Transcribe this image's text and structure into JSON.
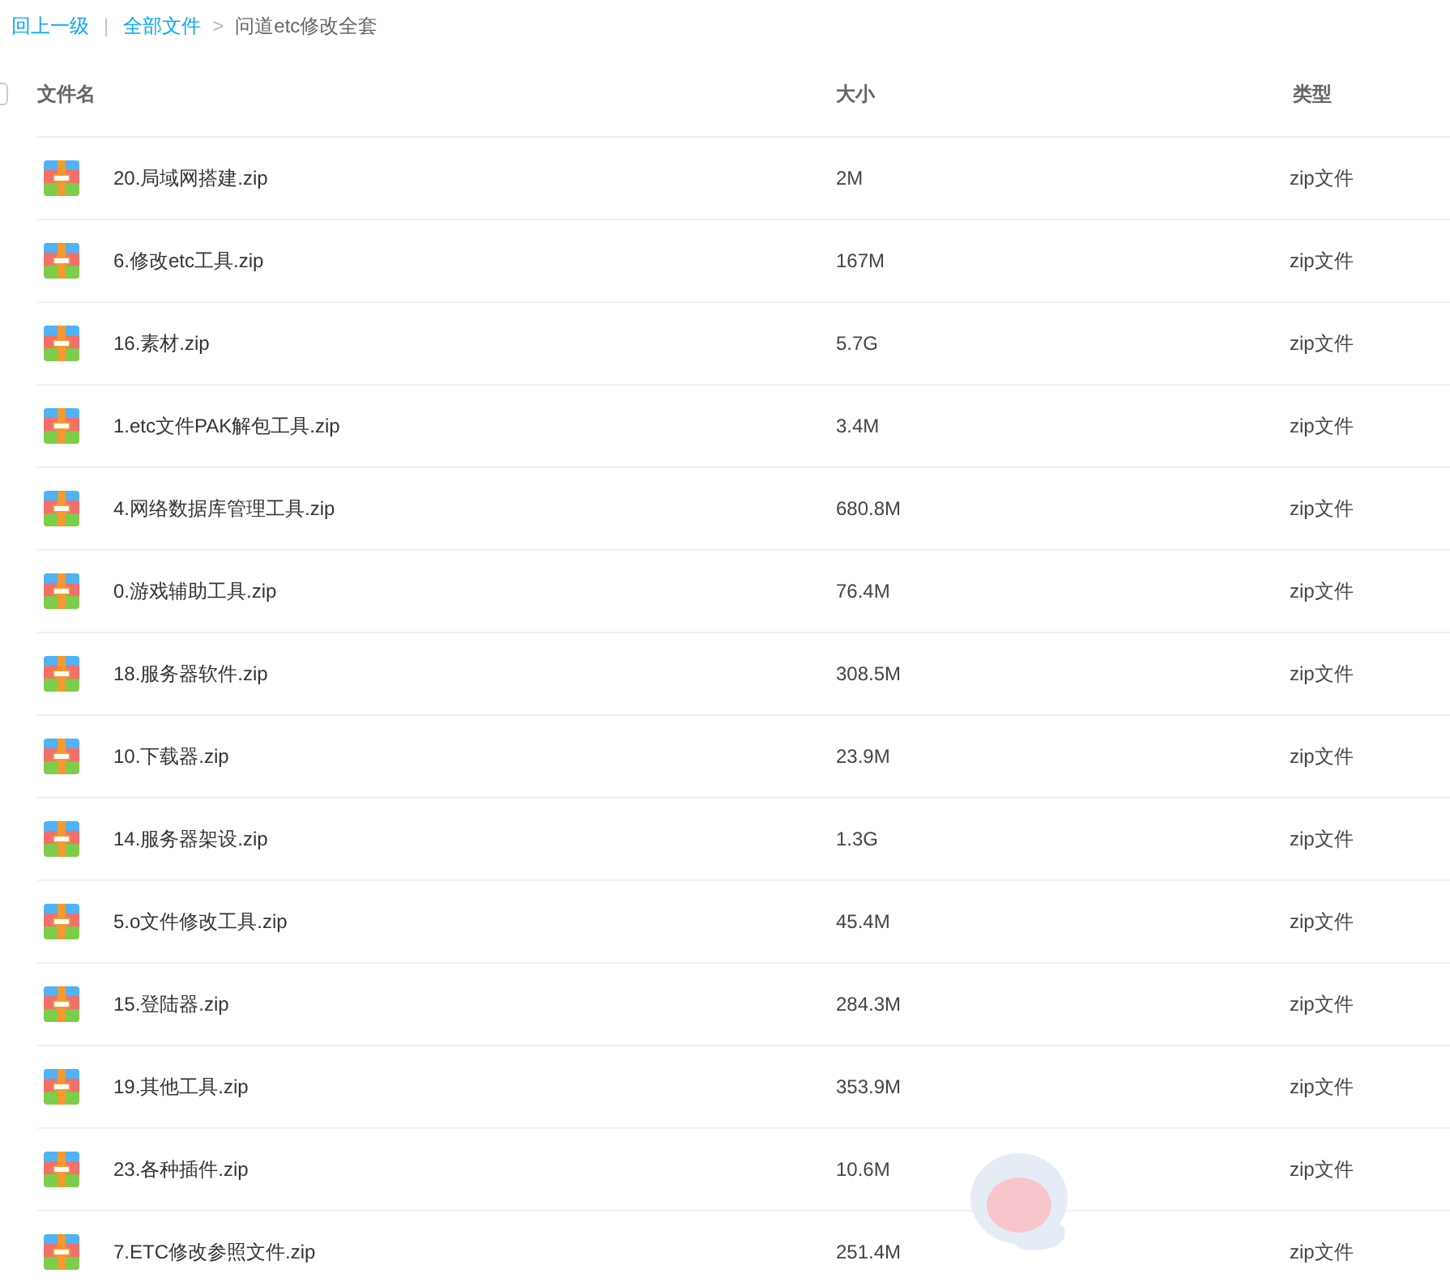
{
  "breadcrumb": {
    "back": "回上一级",
    "separator": "|",
    "items": [
      {
        "label": "全部文件",
        "selected": false
      },
      {
        "label": "问道etc修改全套",
        "selected": true
      }
    ],
    "arrow": ">"
  },
  "table": {
    "select_all": {
      "checked": false
    },
    "columns": [
      "文件名",
      "大小",
      "类型"
    ],
    "rows": [
      {
        "name": "20.局域网搭建.zip",
        "size": "2M",
        "type": "zip文件"
      },
      {
        "name": "6.修改etc工具.zip",
        "size": "167M",
        "type": "zip文件"
      },
      {
        "name": "16.素材.zip",
        "size": "5.7G",
        "type": "zip文件"
      },
      {
        "name": "1.etc文件PAK解包工具.zip",
        "size": "3.4M",
        "type": "zip文件"
      },
      {
        "name": "4.网络数据库管理工具.zip",
        "size": "680.8M",
        "type": "zip文件"
      },
      {
        "name": "0.游戏辅助工具.zip",
        "size": "76.4M",
        "type": "zip文件"
      },
      {
        "name": "18.服务器软件.zip",
        "size": "308.5M",
        "type": "zip文件"
      },
      {
        "name": "10.下载器.zip",
        "size": "23.9M",
        "type": "zip文件"
      },
      {
        "name": "14.服务器架设.zip",
        "size": "1.3G",
        "type": "zip文件"
      },
      {
        "name": "5.o文件修改工具.zip",
        "size": "45.4M",
        "type": "zip文件"
      },
      {
        "name": "15.登陆器.zip",
        "size": "284.3M",
        "type": "zip文件"
      },
      {
        "name": "19.其他工具.zip",
        "size": "353.9M",
        "type": "zip文件"
      },
      {
        "name": "23.各种插件.zip",
        "size": "10.6M",
        "type": "zip文件"
      },
      {
        "name": "7.ETC修改参照文件.zip",
        "size": "251.4M",
        "type": "zip文件"
      }
    ]
  }
}
